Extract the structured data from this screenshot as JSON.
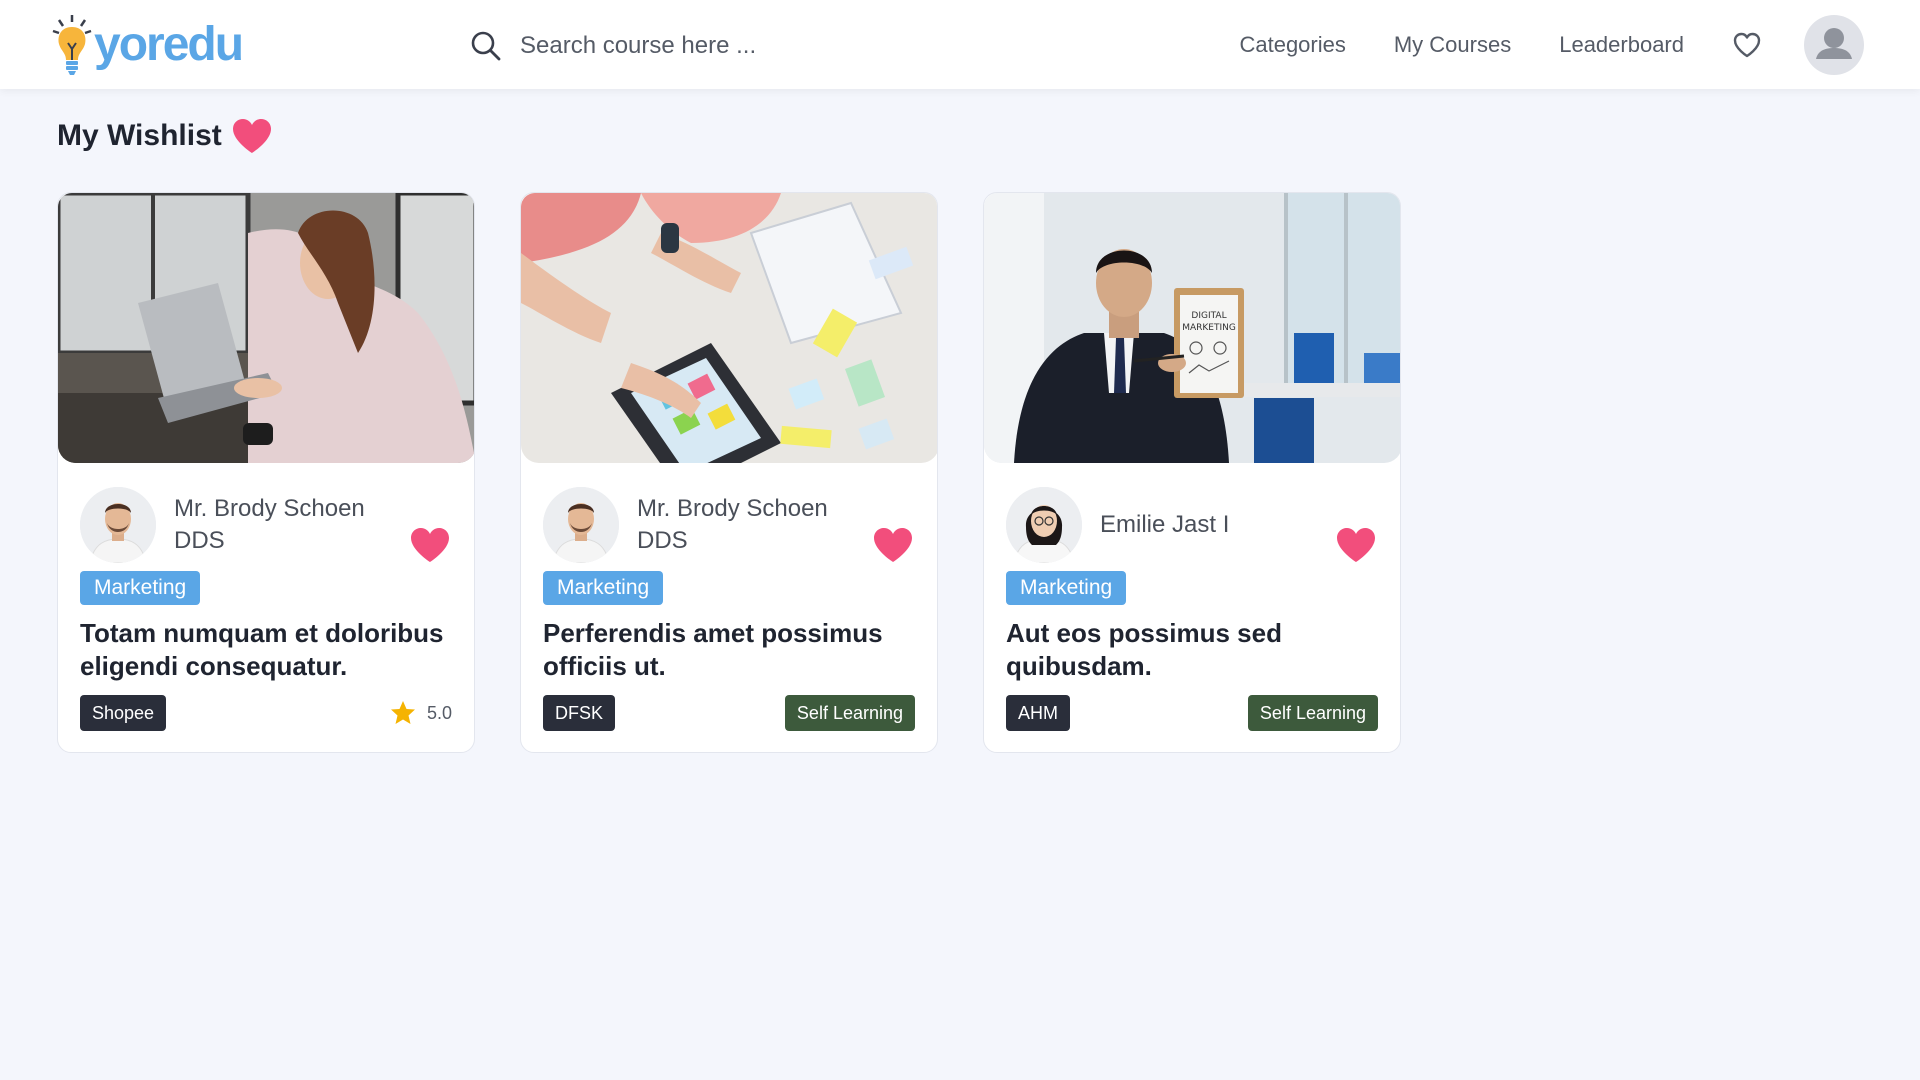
{
  "brand": {
    "name": "yoredu",
    "logo_icon": "lightbulb-icon",
    "color": "#5aa6e6"
  },
  "search": {
    "placeholder": "Search course here ..."
  },
  "nav": {
    "links": [
      "Categories",
      "My Courses",
      "Leaderboard"
    ],
    "wishlist_icon": "heart-outline-icon",
    "avatar_icon": "user-avatar-icon"
  },
  "page": {
    "title": "My Wishlist",
    "title_icon": "heart-icon",
    "heart_color": "#f24e7c"
  },
  "courses": [
    {
      "author": "Mr. Brody Schoen DDS",
      "category": "Marketing",
      "title": "Totam numquam et doloribus eligendi consequatur.",
      "provider": "Shopee",
      "rating": "5.0",
      "type": null,
      "image": "woman-laptop-window-photo"
    },
    {
      "author": "Mr. Brody Schoen DDS",
      "category": "Marketing",
      "title": "Perferendis amet possimus officiis ut.",
      "provider": "DFSK",
      "rating": null,
      "type": "Self Learning",
      "image": "wireframe-sketch-tablet-photo"
    },
    {
      "author": "Emilie Jast I",
      "category": "Marketing",
      "title": "Aut eos possimus sed quibusdam.",
      "provider": "AHM",
      "rating": null,
      "type": "Self Learning",
      "image": "businessman-digital-marketing-photo"
    }
  ],
  "colors": {
    "background": "#f4f6fc",
    "category_badge": "#5aa6e6",
    "provider_badge": "#2a2e3a",
    "type_badge": "#3d5a3c",
    "star": "#f5b301"
  }
}
